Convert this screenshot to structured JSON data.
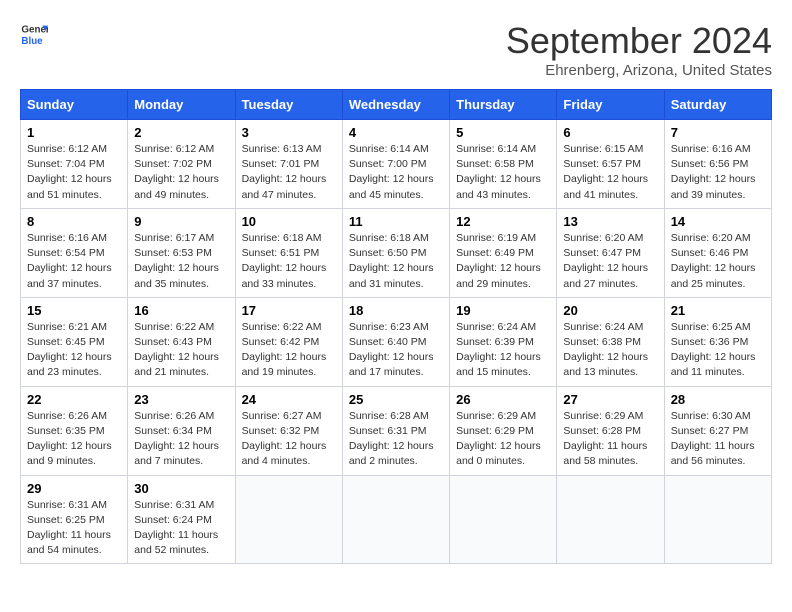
{
  "header": {
    "logo": {
      "line1": "General",
      "line2": "Blue"
    },
    "title": "September 2024",
    "location": "Ehrenberg, Arizona, United States"
  },
  "days_of_week": [
    "Sunday",
    "Monday",
    "Tuesday",
    "Wednesday",
    "Thursday",
    "Friday",
    "Saturday"
  ],
  "weeks": [
    [
      {
        "day": "1",
        "sunrise": "6:12 AM",
        "sunset": "7:04 PM",
        "daylight": "12 hours and 51 minutes."
      },
      {
        "day": "2",
        "sunrise": "6:12 AM",
        "sunset": "7:02 PM",
        "daylight": "12 hours and 49 minutes."
      },
      {
        "day": "3",
        "sunrise": "6:13 AM",
        "sunset": "7:01 PM",
        "daylight": "12 hours and 47 minutes."
      },
      {
        "day": "4",
        "sunrise": "6:14 AM",
        "sunset": "7:00 PM",
        "daylight": "12 hours and 45 minutes."
      },
      {
        "day": "5",
        "sunrise": "6:14 AM",
        "sunset": "6:58 PM",
        "daylight": "12 hours and 43 minutes."
      },
      {
        "day": "6",
        "sunrise": "6:15 AM",
        "sunset": "6:57 PM",
        "daylight": "12 hours and 41 minutes."
      },
      {
        "day": "7",
        "sunrise": "6:16 AM",
        "sunset": "6:56 PM",
        "daylight": "12 hours and 39 minutes."
      }
    ],
    [
      {
        "day": "8",
        "sunrise": "6:16 AM",
        "sunset": "6:54 PM",
        "daylight": "12 hours and 37 minutes."
      },
      {
        "day": "9",
        "sunrise": "6:17 AM",
        "sunset": "6:53 PM",
        "daylight": "12 hours and 35 minutes."
      },
      {
        "day": "10",
        "sunrise": "6:18 AM",
        "sunset": "6:51 PM",
        "daylight": "12 hours and 33 minutes."
      },
      {
        "day": "11",
        "sunrise": "6:18 AM",
        "sunset": "6:50 PM",
        "daylight": "12 hours and 31 minutes."
      },
      {
        "day": "12",
        "sunrise": "6:19 AM",
        "sunset": "6:49 PM",
        "daylight": "12 hours and 29 minutes."
      },
      {
        "day": "13",
        "sunrise": "6:20 AM",
        "sunset": "6:47 PM",
        "daylight": "12 hours and 27 minutes."
      },
      {
        "day": "14",
        "sunrise": "6:20 AM",
        "sunset": "6:46 PM",
        "daylight": "12 hours and 25 minutes."
      }
    ],
    [
      {
        "day": "15",
        "sunrise": "6:21 AM",
        "sunset": "6:45 PM",
        "daylight": "12 hours and 23 minutes."
      },
      {
        "day": "16",
        "sunrise": "6:22 AM",
        "sunset": "6:43 PM",
        "daylight": "12 hours and 21 minutes."
      },
      {
        "day": "17",
        "sunrise": "6:22 AM",
        "sunset": "6:42 PM",
        "daylight": "12 hours and 19 minutes."
      },
      {
        "day": "18",
        "sunrise": "6:23 AM",
        "sunset": "6:40 PM",
        "daylight": "12 hours and 17 minutes."
      },
      {
        "day": "19",
        "sunrise": "6:24 AM",
        "sunset": "6:39 PM",
        "daylight": "12 hours and 15 minutes."
      },
      {
        "day": "20",
        "sunrise": "6:24 AM",
        "sunset": "6:38 PM",
        "daylight": "12 hours and 13 minutes."
      },
      {
        "day": "21",
        "sunrise": "6:25 AM",
        "sunset": "6:36 PM",
        "daylight": "12 hours and 11 minutes."
      }
    ],
    [
      {
        "day": "22",
        "sunrise": "6:26 AM",
        "sunset": "6:35 PM",
        "daylight": "12 hours and 9 minutes."
      },
      {
        "day": "23",
        "sunrise": "6:26 AM",
        "sunset": "6:34 PM",
        "daylight": "12 hours and 7 minutes."
      },
      {
        "day": "24",
        "sunrise": "6:27 AM",
        "sunset": "6:32 PM",
        "daylight": "12 hours and 4 minutes."
      },
      {
        "day": "25",
        "sunrise": "6:28 AM",
        "sunset": "6:31 PM",
        "daylight": "12 hours and 2 minutes."
      },
      {
        "day": "26",
        "sunrise": "6:29 AM",
        "sunset": "6:29 PM",
        "daylight": "12 hours and 0 minutes."
      },
      {
        "day": "27",
        "sunrise": "6:29 AM",
        "sunset": "6:28 PM",
        "daylight": "11 hours and 58 minutes."
      },
      {
        "day": "28",
        "sunrise": "6:30 AM",
        "sunset": "6:27 PM",
        "daylight": "11 hours and 56 minutes."
      }
    ],
    [
      {
        "day": "29",
        "sunrise": "6:31 AM",
        "sunset": "6:25 PM",
        "daylight": "11 hours and 54 minutes."
      },
      {
        "day": "30",
        "sunrise": "6:31 AM",
        "sunset": "6:24 PM",
        "daylight": "11 hours and 52 minutes."
      },
      null,
      null,
      null,
      null,
      null
    ]
  ]
}
